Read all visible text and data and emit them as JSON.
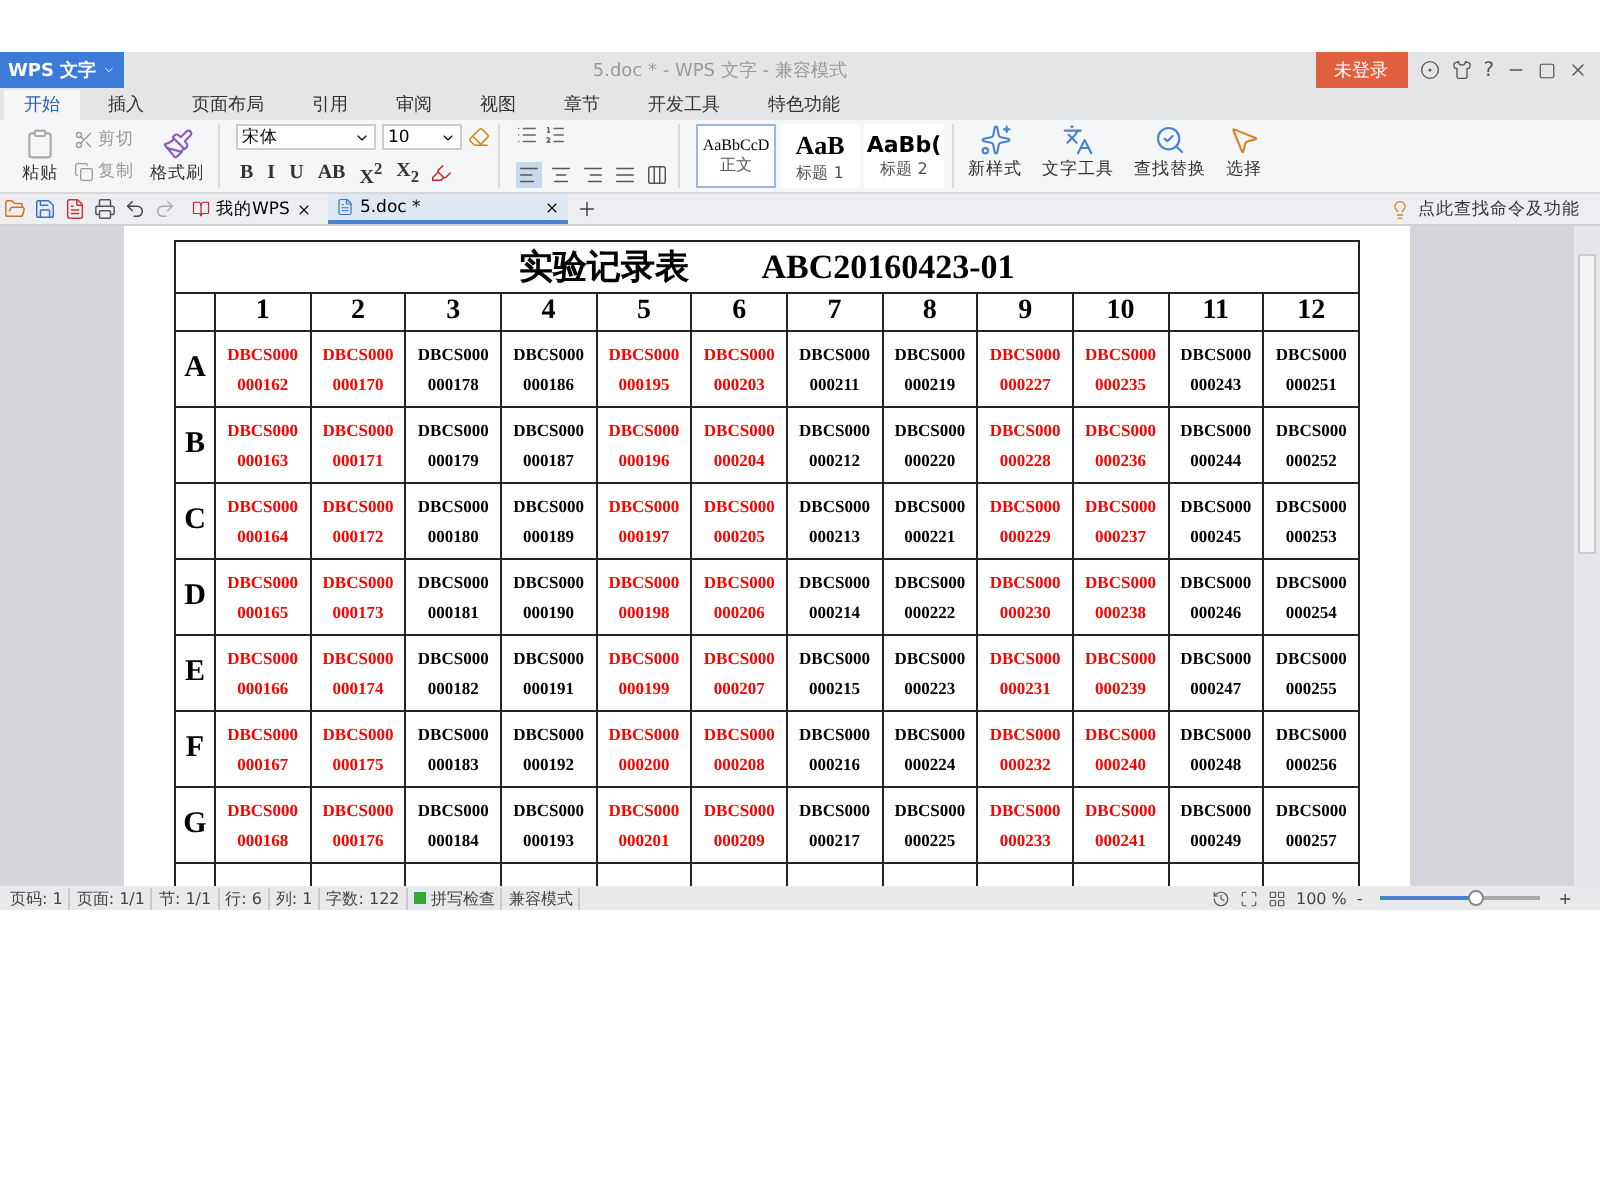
{
  "window": {
    "app_button": "WPS 文字",
    "title": "5.doc * - WPS 文字 - 兼容模式",
    "login_button": "未登录",
    "help": "?"
  },
  "ribbon_tabs": [
    {
      "label": "开始",
      "selected": true
    },
    {
      "label": "插入",
      "selected": false
    },
    {
      "label": "页面布局",
      "selected": false
    },
    {
      "label": "引用",
      "selected": false
    },
    {
      "label": "审阅",
      "selected": false
    },
    {
      "label": "视图",
      "selected": false
    },
    {
      "label": "章节",
      "selected": false
    },
    {
      "label": "开发工具",
      "selected": false
    },
    {
      "label": "特色功能",
      "selected": false
    }
  ],
  "clipboard": {
    "paste": "粘贴",
    "cut": "剪切",
    "copy": "复制",
    "format_painter": "格式刷"
  },
  "font": {
    "name": "宋体",
    "size": "10",
    "format_buttons": [
      "B",
      "I",
      "U",
      "AB",
      "X$^{2}$",
      "X$_{2}$"
    ]
  },
  "alignments": [
    {
      "kind": "left",
      "selected": true
    },
    {
      "kind": "center",
      "selected": false
    },
    {
      "kind": "right",
      "selected": false
    },
    {
      "kind": "justify",
      "selected": false
    },
    {
      "kind": "distributed",
      "selected": false
    }
  ],
  "styles": [
    {
      "preview": "AaBbCcD",
      "label": "正文",
      "selected": true,
      "kind": "body"
    },
    {
      "preview": "AaB",
      "label": "标题 1",
      "selected": false,
      "kind": "h1"
    },
    {
      "preview": "AaBb(",
      "label": "标题 2",
      "selected": false,
      "kind": "h2"
    }
  ],
  "tools": [
    {
      "kind": "new-style",
      "label": "新样式"
    },
    {
      "kind": "text-tools",
      "label": "文字工具"
    },
    {
      "kind": "find",
      "label": "查找替换"
    },
    {
      "kind": "select",
      "label": "选择"
    }
  ],
  "doc_tabs": [
    {
      "label": "我的WPS",
      "selected": false,
      "kind": "home"
    },
    {
      "label": "5.doc *",
      "selected": true,
      "kind": "doc"
    }
  ],
  "command_search": "点此查找命令及功能",
  "table": {
    "title": "实验记录表",
    "code": "ABC20160423-01",
    "columns": [
      "1",
      "2",
      "3",
      "4",
      "5",
      "6",
      "7",
      "8",
      "9",
      "10",
      "11",
      "12"
    ],
    "rows": [
      {
        "label": "A",
        "cells": [
          {
            "code": "DBCS000",
            "number": "000162",
            "color": "#ff0000"
          },
          {
            "code": "DBCS000",
            "number": "000170",
            "color": "#ff0000"
          },
          {
            "code": "DBCS000",
            "number": "000178",
            "color": "#000000"
          },
          {
            "code": "DBCS000",
            "number": "000186",
            "color": "#000000"
          },
          {
            "code": "DBCS000",
            "number": "000195",
            "color": "#ff0000"
          },
          {
            "code": "DBCS000",
            "number": "000203",
            "color": "#ff0000"
          },
          {
            "code": "DBCS000",
            "number": "000211",
            "color": "#000000"
          },
          {
            "code": "DBCS000",
            "number": "000219",
            "color": "#000000"
          },
          {
            "code": "DBCS000",
            "number": "000227",
            "color": "#ff0000"
          },
          {
            "code": "DBCS000",
            "number": "000235",
            "color": "#ff0000"
          },
          {
            "code": "DBCS000",
            "number": "000243",
            "color": "#000000"
          },
          {
            "code": "DBCS000",
            "number": "000251",
            "color": "#000000"
          }
        ]
      },
      {
        "label": "B",
        "cells": [
          {
            "code": "DBCS000",
            "number": "000163",
            "color": "#ff0000"
          },
          {
            "code": "DBCS000",
            "number": "000171",
            "color": "#ff0000"
          },
          {
            "code": "DBCS000",
            "number": "000179",
            "color": "#000000"
          },
          {
            "code": "DBCS000",
            "number": "000187",
            "color": "#000000"
          },
          {
            "code": "DBCS000",
            "number": "000196",
            "color": "#ff0000"
          },
          {
            "code": "DBCS000",
            "number": "000204",
            "color": "#ff0000"
          },
          {
            "code": "DBCS000",
            "number": "000212",
            "color": "#000000"
          },
          {
            "code": "DBCS000",
            "number": "000220",
            "color": "#000000"
          },
          {
            "code": "DBCS000",
            "number": "000228",
            "color": "#ff0000"
          },
          {
            "code": "DBCS000",
            "number": "000236",
            "color": "#ff0000"
          },
          {
            "code": "DBCS000",
            "number": "000244",
            "color": "#000000"
          },
          {
            "code": "DBCS000",
            "number": "000252",
            "color": "#000000"
          }
        ]
      },
      {
        "label": "C",
        "cells": [
          {
            "code": "DBCS000",
            "number": "000164",
            "color": "#ff0000"
          },
          {
            "code": "DBCS000",
            "number": "000172",
            "color": "#ff0000"
          },
          {
            "code": "DBCS000",
            "number": "000180",
            "color": "#000000"
          },
          {
            "code": "DBCS000",
            "number": "000189",
            "color": "#000000"
          },
          {
            "code": "DBCS000",
            "number": "000197",
            "color": "#ff0000"
          },
          {
            "code": "DBCS000",
            "number": "000205",
            "color": "#ff0000"
          },
          {
            "code": "DBCS000",
            "number": "000213",
            "color": "#000000"
          },
          {
            "code": "DBCS000",
            "number": "000221",
            "color": "#000000"
          },
          {
            "code": "DBCS000",
            "number": "000229",
            "color": "#ff0000"
          },
          {
            "code": "DBCS000",
            "number": "000237",
            "color": "#ff0000"
          },
          {
            "code": "DBCS000",
            "number": "000245",
            "color": "#000000"
          },
          {
            "code": "DBCS000",
            "number": "000253",
            "color": "#000000"
          }
        ]
      },
      {
        "label": "D",
        "cells": [
          {
            "code": "DBCS000",
            "number": "000165",
            "color": "#ff0000"
          },
          {
            "code": "DBCS000",
            "number": "000173",
            "color": "#ff0000"
          },
          {
            "code": "DBCS000",
            "number": "000181",
            "color": "#000000"
          },
          {
            "code": "DBCS000",
            "number": "000190",
            "color": "#000000"
          },
          {
            "code": "DBCS000",
            "number": "000198",
            "color": "#ff0000"
          },
          {
            "code": "DBCS000",
            "number": "000206",
            "color": "#ff0000"
          },
          {
            "code": "DBCS000",
            "number": "000214",
            "color": "#000000"
          },
          {
            "code": "DBCS000",
            "number": "000222",
            "color": "#000000"
          },
          {
            "code": "DBCS000",
            "number": "000230",
            "color": "#ff0000"
          },
          {
            "code": "DBCS000",
            "number": "000238",
            "color": "#ff0000"
          },
          {
            "code": "DBCS000",
            "number": "000246",
            "color": "#000000"
          },
          {
            "code": "DBCS000",
            "number": "000254",
            "color": "#000000"
          }
        ]
      },
      {
        "label": "E",
        "cells": [
          {
            "code": "DBCS000",
            "number": "000166",
            "color": "#ff0000"
          },
          {
            "code": "DBCS000",
            "number": "000174",
            "color": "#ff0000"
          },
          {
            "code": "DBCS000",
            "number": "000182",
            "color": "#000000"
          },
          {
            "code": "DBCS000",
            "number": "000191",
            "color": "#000000"
          },
          {
            "code": "DBCS000",
            "number": "000199",
            "color": "#ff0000"
          },
          {
            "code": "DBCS000",
            "number": "000207",
            "color": "#ff0000"
          },
          {
            "code": "DBCS000",
            "number": "000215",
            "color": "#000000"
          },
          {
            "code": "DBCS000",
            "number": "000223",
            "color": "#000000"
          },
          {
            "code": "DBCS000",
            "number": "000231",
            "color": "#ff0000"
          },
          {
            "code": "DBCS000",
            "number": "000239",
            "color": "#ff0000"
          },
          {
            "code": "DBCS000",
            "number": "000247",
            "color": "#000000"
          },
          {
            "code": "DBCS000",
            "number": "000255",
            "color": "#000000"
          }
        ]
      },
      {
        "label": "F",
        "cells": [
          {
            "code": "DBCS000",
            "number": "000167",
            "color": "#ff0000"
          },
          {
            "code": "DBCS000",
            "number": "000175",
            "color": "#ff0000"
          },
          {
            "code": "DBCS000",
            "number": "000183",
            "color": "#000000"
          },
          {
            "code": "DBCS000",
            "number": "000192",
            "color": "#000000"
          },
          {
            "code": "DBCS000",
            "number": "000200",
            "color": "#ff0000"
          },
          {
            "code": "DBCS000",
            "number": "000208",
            "color": "#ff0000"
          },
          {
            "code": "DBCS000",
            "number": "000216",
            "color": "#000000"
          },
          {
            "code": "DBCS000",
            "number": "000224",
            "color": "#000000"
          },
          {
            "code": "DBCS000",
            "number": "000232",
            "color": "#ff0000"
          },
          {
            "code": "DBCS000",
            "number": "000240",
            "color": "#ff0000"
          },
          {
            "code": "DBCS000",
            "number": "000248",
            "color": "#000000"
          },
          {
            "code": "DBCS000",
            "number": "000256",
            "color": "#000000"
          }
        ]
      },
      {
        "label": "G",
        "cells": [
          {
            "code": "DBCS000",
            "number": "000168",
            "color": "#ff0000"
          },
          {
            "code": "DBCS000",
            "number": "000176",
            "color": "#ff0000"
          },
          {
            "code": "DBCS000",
            "number": "000184",
            "color": "#000000"
          },
          {
            "code": "DBCS000",
            "number": "000193",
            "color": "#000000"
          },
          {
            "code": "DBCS000",
            "number": "000201",
            "color": "#ff0000"
          },
          {
            "code": "DBCS000",
            "number": "000209",
            "color": "#ff0000"
          },
          {
            "code": "DBCS000",
            "number": "000217",
            "color": "#000000"
          },
          {
            "code": "DBCS000",
            "number": "000225",
            "color": "#000000"
          },
          {
            "code": "DBCS000",
            "number": "000233",
            "color": "#ff0000"
          },
          {
            "code": "DBCS000",
            "number": "000241",
            "color": "#ff0000"
          },
          {
            "code": "DBCS000",
            "number": "000249",
            "color": "#000000"
          },
          {
            "code": "DBCS000",
            "number": "000257",
            "color": "#000000"
          }
        ]
      }
    ]
  },
  "status_bar": {
    "items": [
      "页码: 1",
      "页面: 1/1",
      "节: 1/1",
      "行: 6",
      "列: 1",
      "字数: 122",
      "拼写检查",
      "兼容模式"
    ],
    "zoom": "100 %",
    "zoom_slider": {
      "level": 0.6
    },
    "minus": "-",
    "plus": "+"
  }
}
